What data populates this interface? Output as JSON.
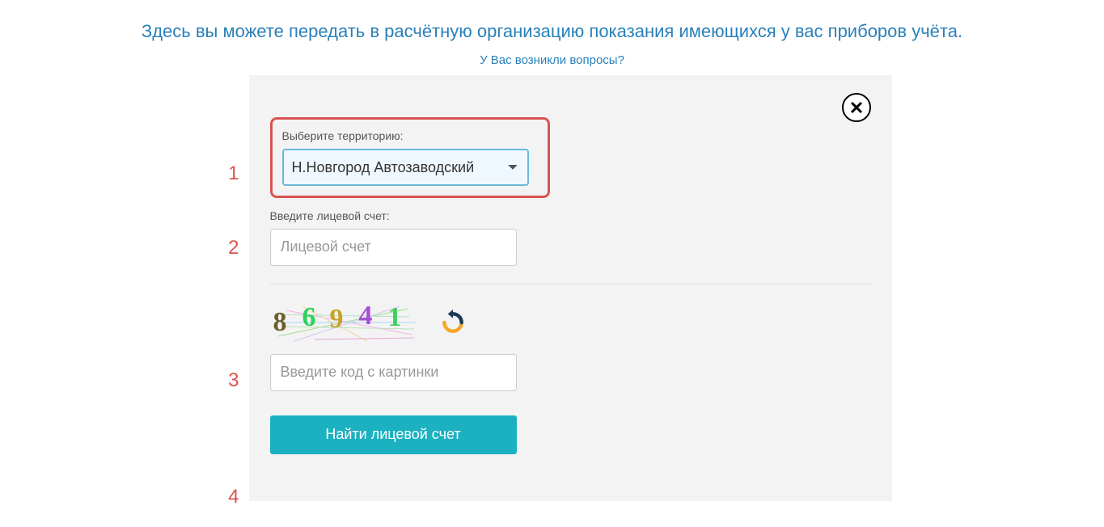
{
  "header": {
    "title": "Здесь вы можете передать в расчётную организацию показания имеющихся у вас приборов учёта.",
    "questions_link": "У Вас возникли вопросы?"
  },
  "steps": {
    "s1": "1",
    "s2": "2",
    "s3": "3",
    "s4": "4"
  },
  "form": {
    "territory_label": "Выберите территорию:",
    "territory_value": "Н.Новгород Автозаводский",
    "account_label": "Введите лицевой счет:",
    "account_placeholder": "Лицевой счет",
    "captcha_placeholder": "Введите код с картинки",
    "captcha_code": "86941",
    "find_button": "Найти лицевой счет"
  },
  "captcha_digits": [
    {
      "char": "8",
      "color": "#6b5f2b"
    },
    {
      "char": "6",
      "color": "#2bd35a"
    },
    {
      "char": "9",
      "color": "#c9a227"
    },
    {
      "char": "4",
      "color": "#a64fd6"
    },
    {
      "char": "1",
      "color": "#3fcf5c"
    }
  ]
}
